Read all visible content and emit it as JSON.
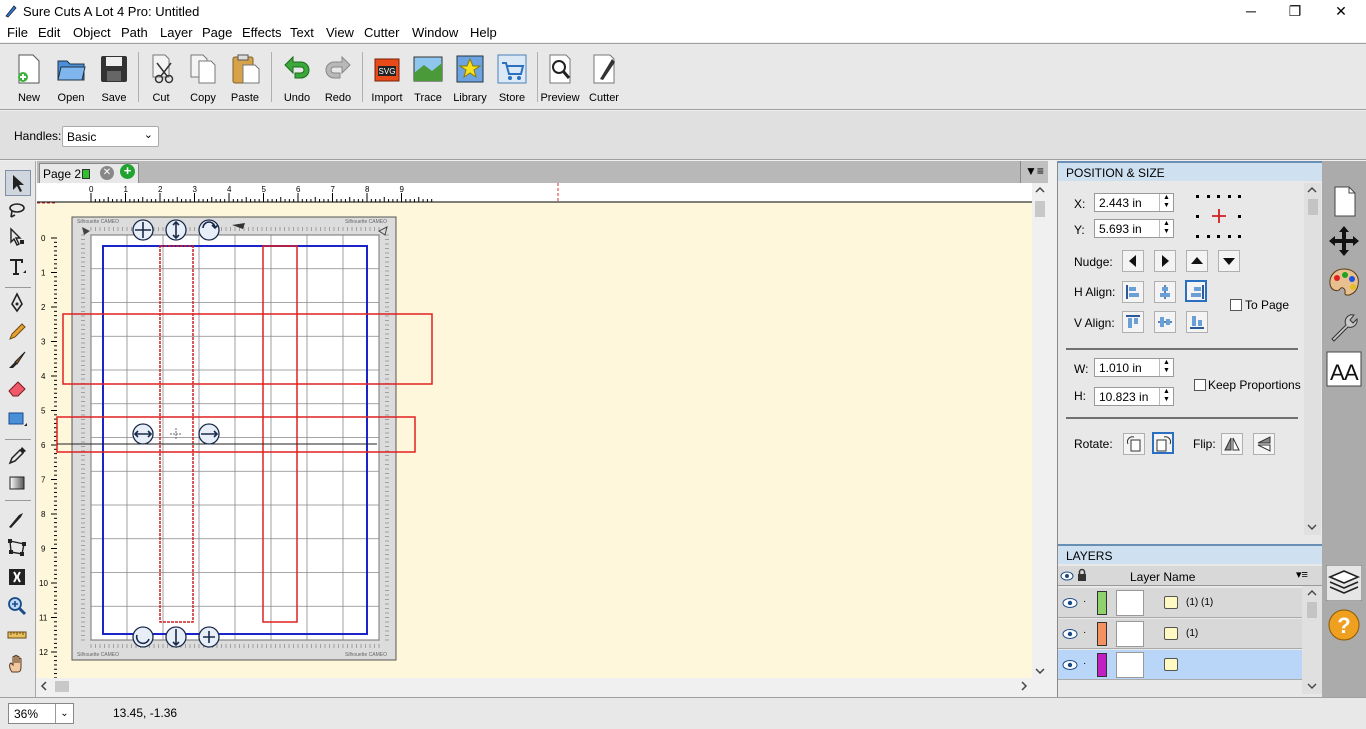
{
  "app": {
    "title": "Sure Cuts A Lot 4 Pro: Untitled",
    "window_controls": [
      "─",
      "❐",
      "✕"
    ]
  },
  "menu": [
    "File",
    "Edit",
    "Object",
    "Path",
    "Layer",
    "Page",
    "Effects",
    "Text",
    "View",
    "Cutter",
    "Window",
    "Help"
  ],
  "toolbar": {
    "new": "New",
    "open": "Open",
    "save": "Save",
    "cut": "Cut",
    "copy": "Copy",
    "paste": "Paste",
    "undo": "Undo",
    "redo": "Redo",
    "import": "Import",
    "trace": "Trace",
    "library": "Library",
    "store": "Store",
    "preview": "Preview",
    "cutter": "Cutter"
  },
  "handles": {
    "label": "Handles:",
    "value": "Basic"
  },
  "tabs": {
    "page_label": "Page 2",
    "menu_glyph": "▼≡"
  },
  "ruler": {
    "top_ticks": [
      "0",
      "1",
      "2",
      "3",
      "4",
      "5",
      "6",
      "7",
      "8",
      "9"
    ],
    "left_ticks": [
      "0",
      "1",
      "2",
      "3",
      "4",
      "5",
      "6",
      "7",
      "8",
      "9",
      "10",
      "11",
      "12"
    ]
  },
  "mat": {
    "brand_text": "Silhouette CAMEO"
  },
  "position_size": {
    "header": "POSITION & SIZE",
    "x_label": "X:",
    "x_value": "2.443 in",
    "y_label": "Y:",
    "y_value": "5.693 in",
    "nudge_label": "Nudge:",
    "h_align_label": "H Align:",
    "v_align_label": "V Align:",
    "to_page_label": "To Page",
    "w_label": "W:",
    "w_value": "1.010 in",
    "h_label": "H:",
    "h_value": "10.823 in",
    "keep_proportions_label": "Keep Proportions",
    "rotate_label": "Rotate:",
    "flip_label": "Flip:"
  },
  "layers": {
    "header": "LAYERS",
    "column_name": "Layer Name",
    "rows": [
      {
        "name": "(1) (1)",
        "color": "#8fd16a",
        "selected": false
      },
      {
        "name": "(1)",
        "color": "#f59060",
        "selected": false
      },
      {
        "name": "",
        "color": "#c21fc2",
        "selected": true
      }
    ]
  },
  "status": {
    "zoom": "36%",
    "coords": "13.45, -1.36"
  }
}
